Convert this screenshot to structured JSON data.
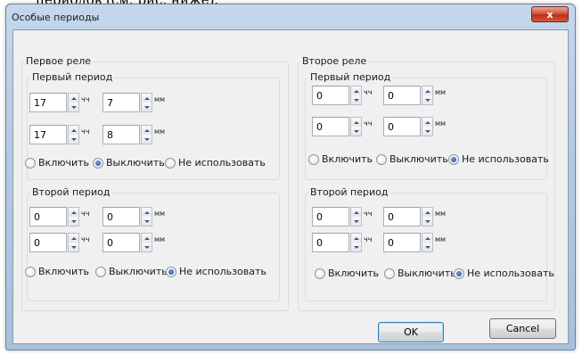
{
  "document": {
    "partial_text": "периодов (см. рис. ниже)."
  },
  "window": {
    "title": "Особые периоды",
    "close_glyph": "x",
    "accent_color": "#c7372f"
  },
  "relays": [
    {
      "label": "Первое реле",
      "periods": [
        {
          "label": "Первый период",
          "rows": [
            {
              "hours": "17",
              "hours_unit": "чч",
              "minutes": "7",
              "minutes_unit": "мм"
            },
            {
              "hours": "17",
              "hours_unit": "чч",
              "minutes": "8",
              "minutes_unit": "мм"
            }
          ],
          "options": [
            "Включить",
            "Выключить",
            "Не использовать"
          ],
          "selected_option": "Выключить"
        },
        {
          "label": "Второй период",
          "rows": [
            {
              "hours": "0",
              "hours_unit": "чч",
              "minutes": "0",
              "minutes_unit": "мм"
            },
            {
              "hours": "0",
              "hours_unit": "чч",
              "minutes": "0",
              "minutes_unit": "мм"
            }
          ],
          "options": [
            "Включить",
            "Выключить",
            "Не использовать"
          ],
          "selected_option": "Не использовать"
        }
      ]
    },
    {
      "label": "Второе реле",
      "periods": [
        {
          "label": "Первый период",
          "rows": [
            {
              "hours": "0",
              "hours_unit": "чч",
              "minutes": "0",
              "minutes_unit": "мм"
            },
            {
              "hours": "0",
              "hours_unit": "чч",
              "minutes": "0",
              "minutes_unit": "мм"
            }
          ],
          "options": [
            "Включить",
            "Выключить",
            "Не использовать"
          ],
          "selected_option": "Не использовать"
        },
        {
          "label": "Второй период",
          "rows": [
            {
              "hours": "0",
              "hours_unit": "чч",
              "minutes": "0",
              "minutes_unit": "мм"
            },
            {
              "hours": "0",
              "hours_unit": "чч",
              "minutes": "0",
              "minutes_unit": "мм"
            }
          ],
          "options": [
            "Включить",
            "Выключить",
            "Не использовать"
          ],
          "selected_option": "Не использовать"
        }
      ]
    }
  ],
  "buttons": {
    "ok_label": "OK",
    "cancel_label": "Cancel"
  }
}
